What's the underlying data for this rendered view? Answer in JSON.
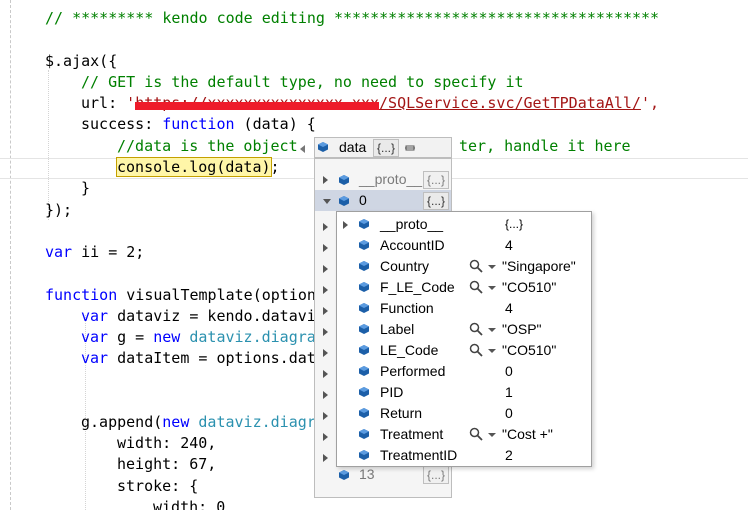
{
  "code": {
    "l1": "// ********* kendo code editing ************************************",
    "l2a": "$.ajax({",
    "l3": "// GET is the default type, no need to specify it",
    "l4a": "url: ",
    "l4q1": "'",
    "l4hidden": "https://xxxxxxxxxxxxxxx.xxx",
    "l4b": "/SQLService.svc/GetTPDataAll/",
    "l4q2": "',",
    "l5a": "success: ",
    "l5b": "function",
    "l5c": " (data) {",
    "l6": "//data is the object returned from server, handle it here",
    "l6visible_end": "ter, handle it here",
    "l6visible_start": "//data is the object",
    "l7": "console.log(data)",
    "l7b": ";",
    "l8": "}",
    "l9": "});",
    "l10a": "var",
    "l10b": " ii = 2;",
    "l11a": "function",
    "l11b": " visualTemplate(option",
    "l12a": "var",
    "l12b": " dataviz = kendo.datavi",
    "l13a": "var",
    "l13b": " g = ",
    "l13c": "new",
    "l13d": " dataviz.diagra",
    "l14a": "var",
    "l14b": " dataItem = options.dat",
    "l15a": "g.append(",
    "l15b": "new",
    "l15c": " dataviz.diagr",
    "l16": "width: 240,",
    "l17": "height: 67,",
    "l18": "stroke: {",
    "l19": "width: 0"
  },
  "datatip": {
    "name": "data",
    "value": "{...}"
  },
  "level1": [
    {
      "name": "__proto__",
      "value": "{...}",
      "dim": true
    },
    {
      "name": "0",
      "value": "{...}",
      "dim": false
    },
    {
      "name": "13",
      "value": "{...}",
      "dim": true
    }
  ],
  "level2": [
    {
      "name": "__proto__",
      "value": "{...}",
      "search": false
    },
    {
      "name": "AccountID",
      "value": "4",
      "search": false
    },
    {
      "name": "Country",
      "value": "\"Singapore\"",
      "search": true
    },
    {
      "name": "F_LE_Code",
      "value": "\"CO510\"",
      "search": true
    },
    {
      "name": "Function",
      "value": "4",
      "search": false
    },
    {
      "name": "Label",
      "value": "\"OSP\"",
      "search": true
    },
    {
      "name": "LE_Code",
      "value": "\"CO510\"",
      "search": true
    },
    {
      "name": "Performed",
      "value": "0",
      "search": false
    },
    {
      "name": "PID",
      "value": "1",
      "search": false
    },
    {
      "name": "Return",
      "value": "0",
      "search": false
    },
    {
      "name": "Treatment",
      "value": "\"Cost +\"",
      "search": true
    },
    {
      "name": "TreatmentID",
      "value": "2",
      "search": false
    }
  ],
  "colors": {
    "comment": "#008000",
    "keyword": "#0000ff",
    "string": "#a31515",
    "type": "#2b91af",
    "redaction": "#ee1b2a",
    "object-icon": "#1c5fa8"
  },
  "icons": {
    "object": "object-cube-icon",
    "search": "magnifier-icon",
    "pin": "pin-icon"
  }
}
